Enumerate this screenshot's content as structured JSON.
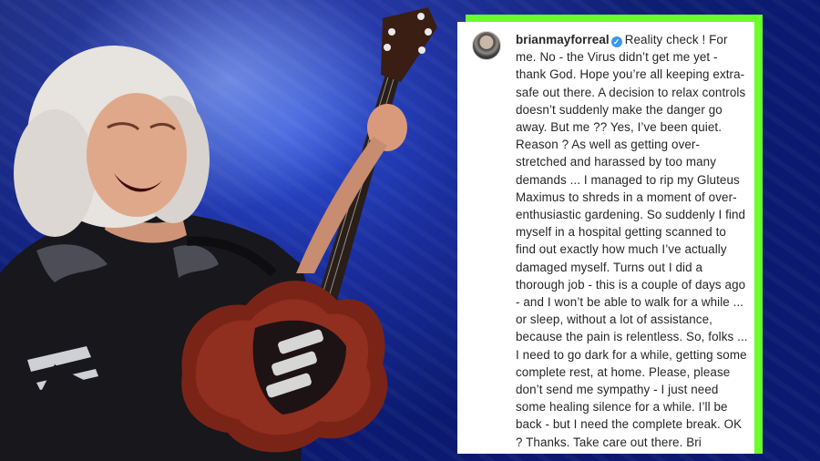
{
  "post": {
    "username": "brianmayforreal",
    "verified": true,
    "caption": "Reality check ! For me. No - the Virus didn’t get me yet - thank God. Hope you’re all keeping extra-safe out there. A decision to relax controls doesn’t suddenly make the danger go away. But me ?? Yes, I’ve been quiet. Reason ? As well as getting over-stretched and harassed by too many demands ... I managed to rip my Gluteus Maximus to shreds in a moment of over-enthusiastic gardening. So suddenly I find myself in a hospital getting scanned to find out exactly how much I’ve actually damaged myself. Turns out I did a thorough job - this is a couple of days ago - and I won’t be able to walk for a while ... or sleep, without a lot of assistance, because the pain is relentless. So, folks ... I need to go dark for a while, getting some complete rest, at home. Please, please don’t send me sympathy - I just need some healing silence for a while. I’ll be back - but I need the complete break. OK ? Thanks. Take care out there. Bri"
  },
  "icons": {
    "verified": "verified-badge-icon",
    "avatar": "profile-avatar"
  },
  "colors": {
    "card_border": "#6bff2a",
    "background": "#1a2e9e",
    "verified_badge": "#3897f0",
    "guitar_body": "#8a2a1e"
  }
}
